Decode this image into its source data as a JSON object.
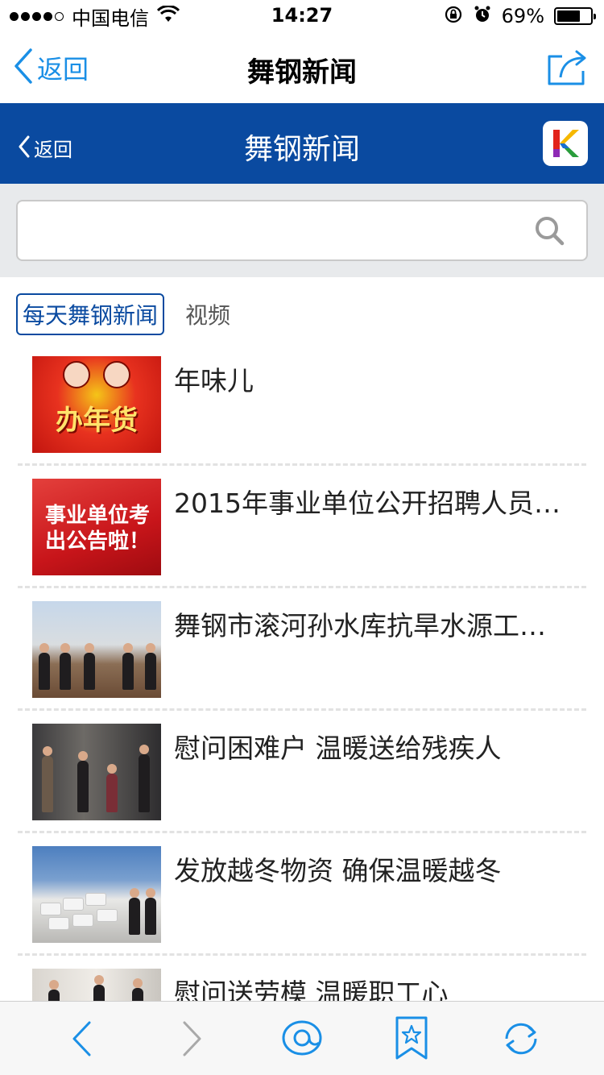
{
  "status_bar": {
    "carrier": "中国电信",
    "time": "14:27",
    "battery_percent": "69%",
    "battery_level": 0.69
  },
  "nav_bar": {
    "back_label": "返回",
    "title": "舞钢新闻"
  },
  "app_header": {
    "back_label": "返回",
    "title": "舞钢新闻"
  },
  "search": {
    "value": "",
    "placeholder": ""
  },
  "tabs": [
    {
      "label": "每天舞钢新闻",
      "active": true
    },
    {
      "label": "视频",
      "active": false
    }
  ],
  "news": [
    {
      "title": "年味儿",
      "thumb_text": "办年货"
    },
    {
      "title": "2015年事业单位公开招聘人员…",
      "thumb_text": "事业单位考出公告啦！"
    },
    {
      "title": "舞钢市滚河孙水库抗旱水源工…"
    },
    {
      "title": "慰问困难户 温暖送给残疾人"
    },
    {
      "title": "发放越冬物资 确保温暖越冬"
    },
    {
      "title": "慰问送劳模 温暖职工心"
    }
  ],
  "colors": {
    "ios_blue": "#1a8fe6",
    "header_blue": "#0a4aa0"
  }
}
